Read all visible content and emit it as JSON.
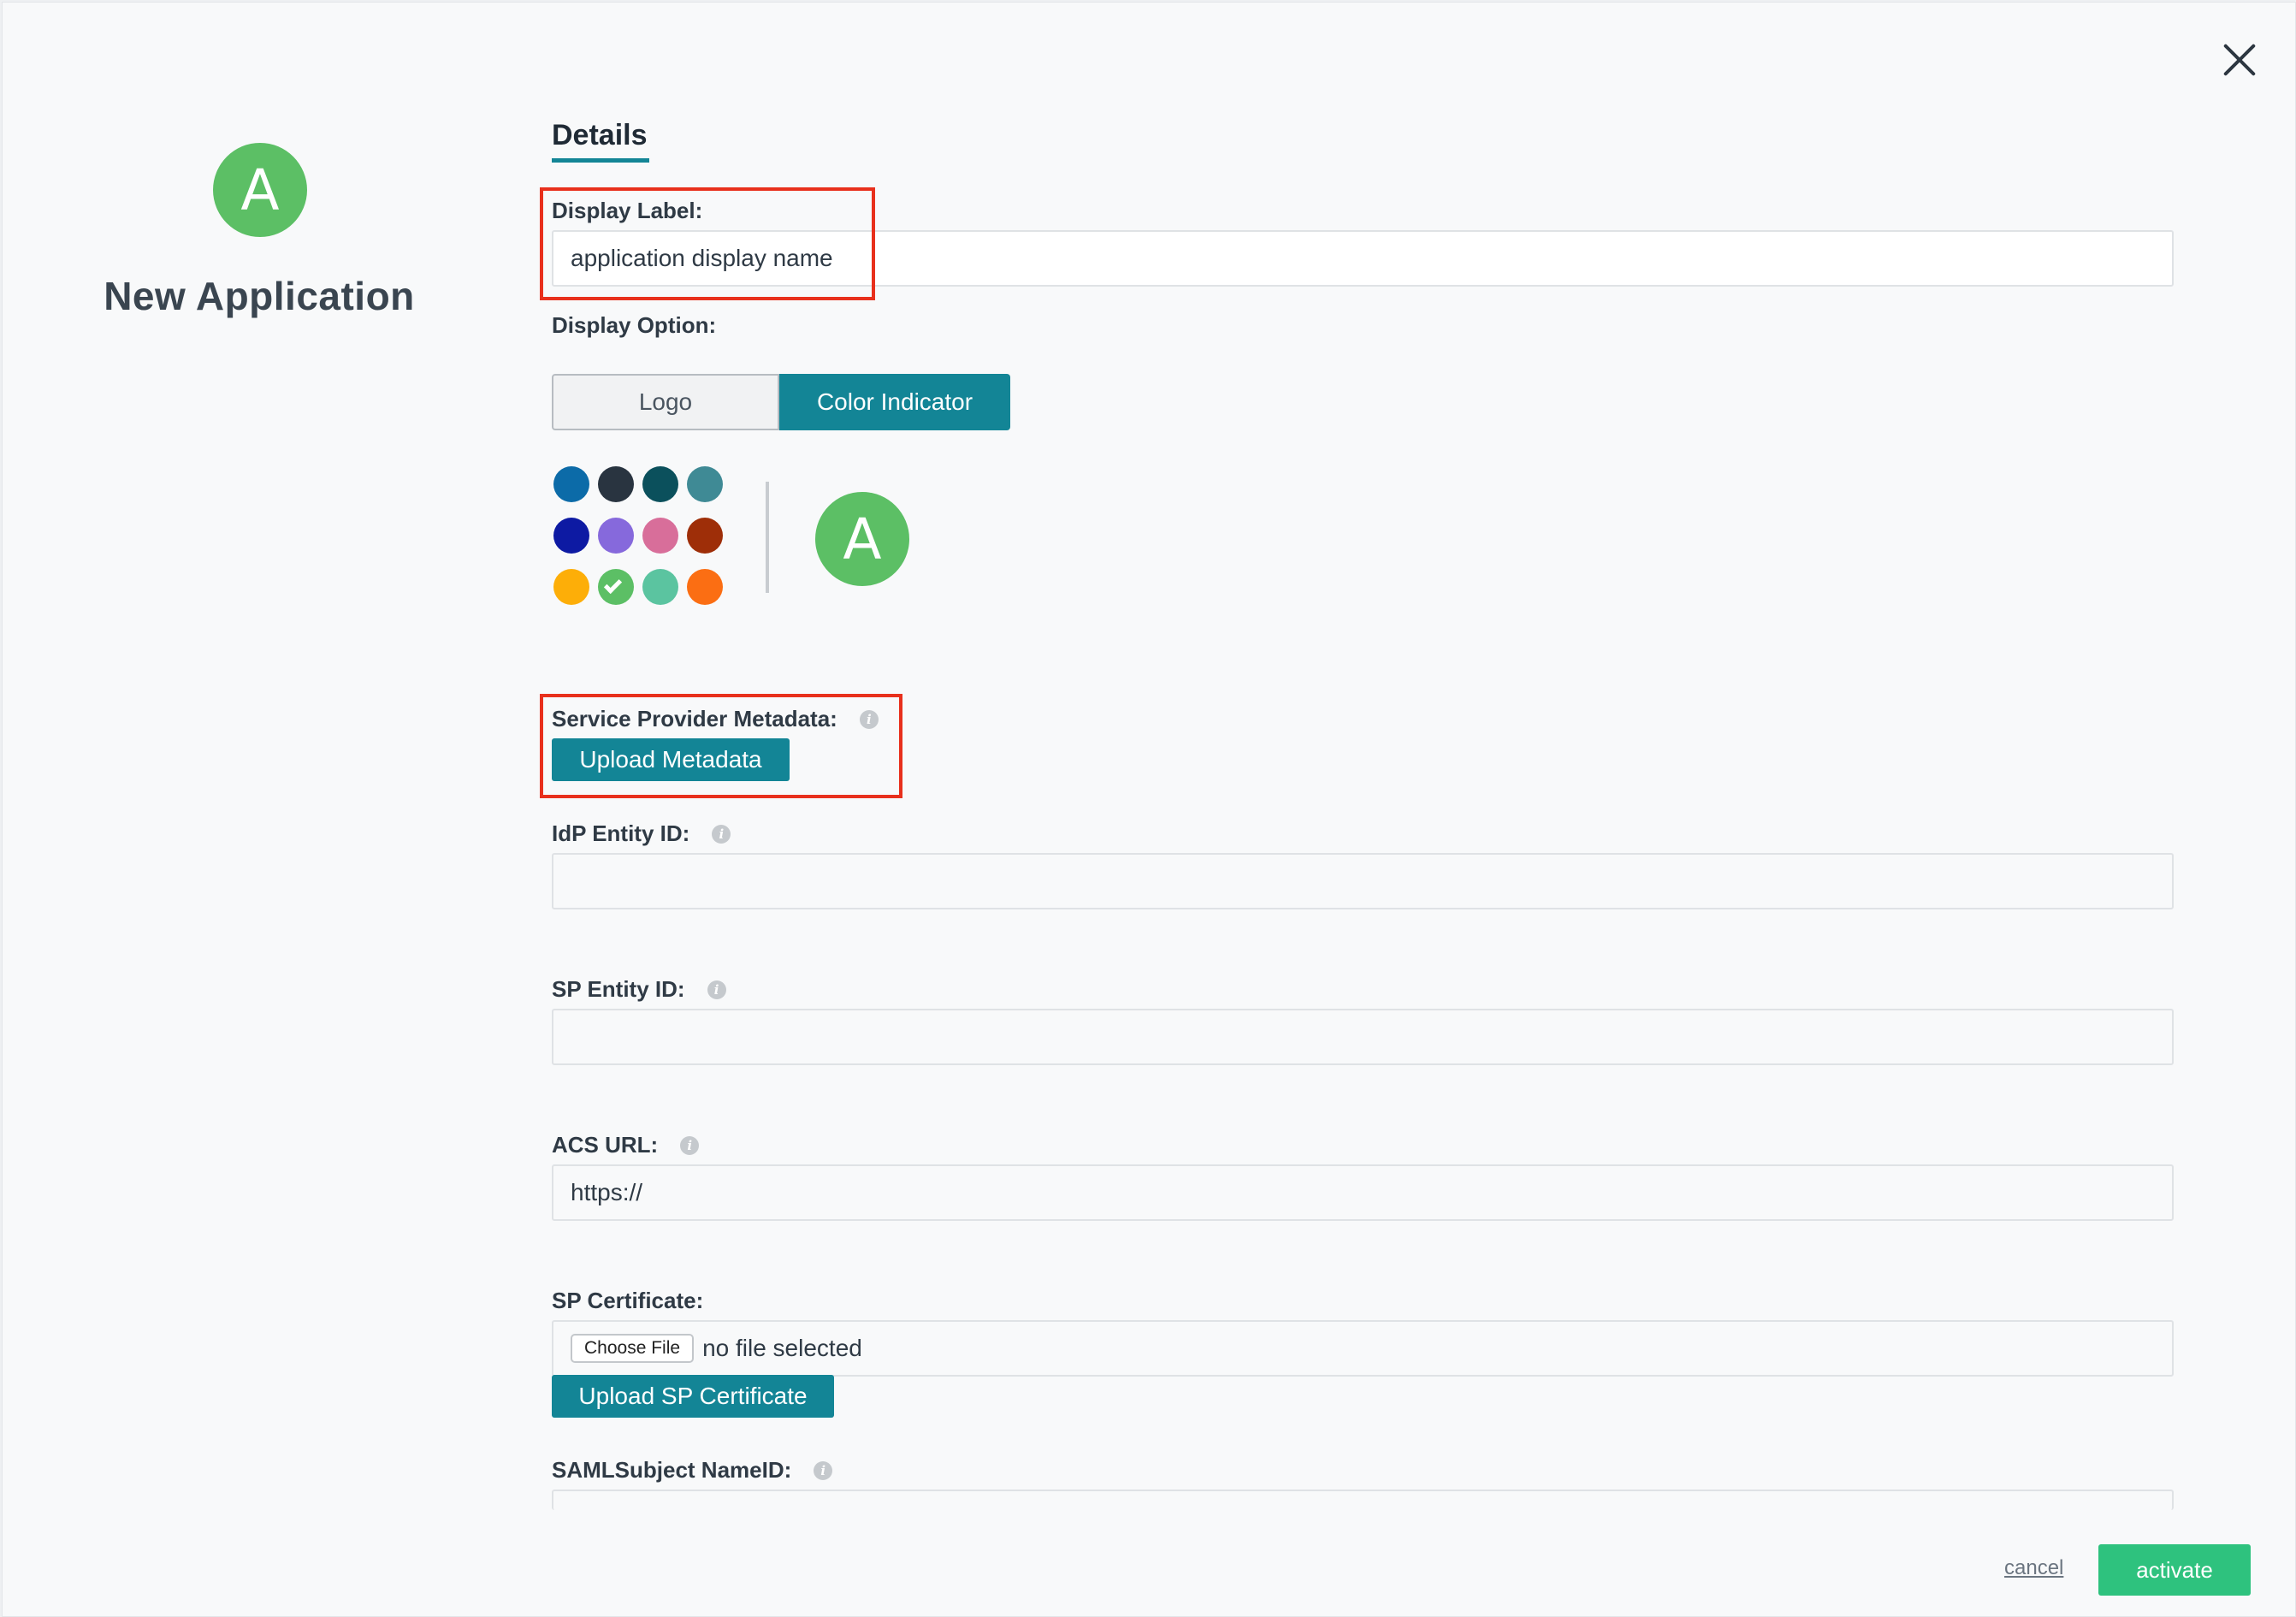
{
  "header": {
    "close_icon": "close-icon"
  },
  "sidebar": {
    "avatar_letter": "A",
    "title": "New Application"
  },
  "tabs": {
    "details": "Details"
  },
  "display_label": {
    "label": "Display Label:",
    "value": "application display name"
  },
  "display_option": {
    "label": "Display Option:",
    "options": [
      "Logo",
      "Color Indicator"
    ],
    "selected": "Color Indicator"
  },
  "colors": {
    "swatches": [
      "#0c6ba8",
      "#293440",
      "#0b505c",
      "#3f8a95",
      "#0d1aa3",
      "#8669dc",
      "#d86e9a",
      "#9e2e08",
      "#fdae08",
      "#5cbf65",
      "#5bc4a0",
      "#fb6e13"
    ],
    "selected": "#5cbf65",
    "preview_letter": "A"
  },
  "sp_metadata": {
    "label": "Service Provider Metadata:",
    "button": "Upload Metadata"
  },
  "idp_entity_id": {
    "label": "IdP Entity ID:",
    "value": ""
  },
  "sp_entity_id": {
    "label": "SP Entity ID:",
    "value": ""
  },
  "acs_url": {
    "label": "ACS URL:",
    "value": "https://"
  },
  "sp_certificate": {
    "label": "SP Certificate:",
    "choose_file": "Choose File",
    "file_status": "no file selected",
    "upload_button": "Upload SP Certificate"
  },
  "saml_subject": {
    "label": "SAMLSubject NameID:"
  },
  "footer": {
    "cancel": "cancel",
    "activate": "activate"
  }
}
